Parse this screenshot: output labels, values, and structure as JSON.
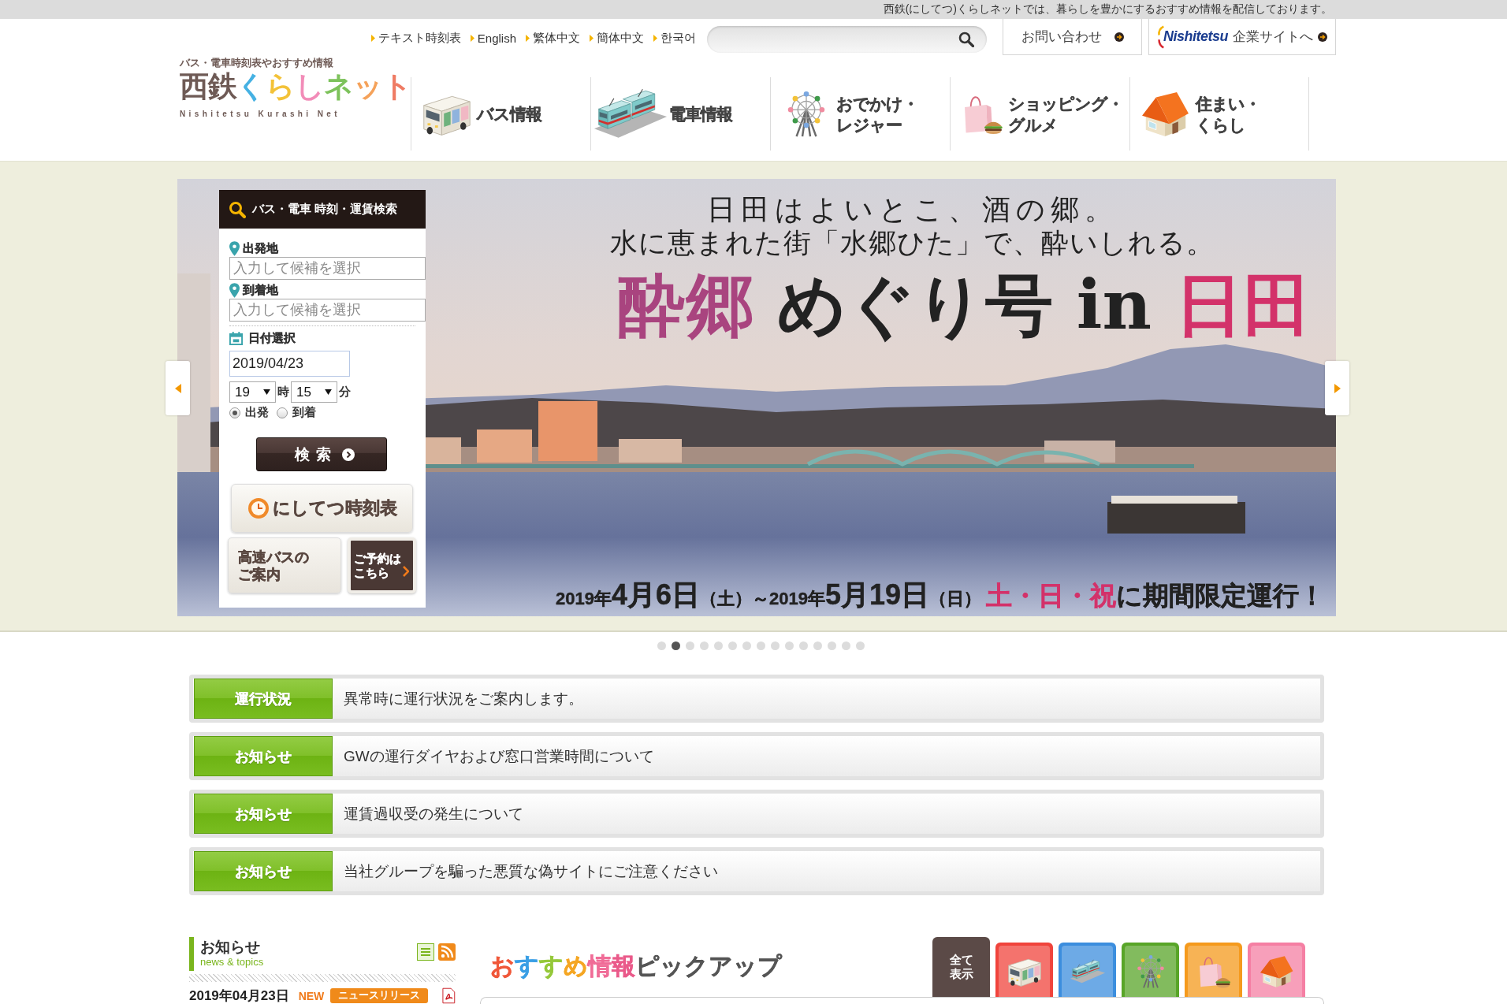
{
  "top_bar": {
    "message": "西鉄(にしてつ)くらしネットでは、暮らしを豊かにするおすすめ情報を配信しております。"
  },
  "header": {
    "language_links": [
      "テキスト時刻表",
      "English",
      "繁体中文",
      "簡体中文",
      "한국어"
    ],
    "contact_button": "お問い合わせ",
    "corporate_link": {
      "brand": "Nishitetsu",
      "label": "企業サイトへ"
    },
    "logo": {
      "tagline": "バス・電車時刻表やおすすめ情報",
      "name": "西鉄くらしネット",
      "romaji": "Nishitetsu Kurashi Net"
    }
  },
  "nav": [
    {
      "kind": "bus",
      "lines": [
        "バス情報"
      ]
    },
    {
      "kind": "train",
      "lines": [
        "電車情報"
      ]
    },
    {
      "kind": "ferris_wheel",
      "lines": [
        "おでかけ・",
        "レジャー"
      ]
    },
    {
      "kind": "shopping",
      "lines": [
        "ショッピング・",
        "グルメ"
      ]
    },
    {
      "kind": "house",
      "lines": [
        "住まい・",
        "くらし"
      ]
    }
  ],
  "route_search": {
    "title": "バス・電車 時刻・運賃検索",
    "origin": {
      "label": "出発地",
      "placeholder": "入力して候補を選択"
    },
    "destination": {
      "label": "到着地",
      "placeholder": "入力して候補を選択"
    },
    "date": {
      "label": "日付選択",
      "value": "2019/04/23"
    },
    "hour": {
      "value": "19",
      "unit": "時"
    },
    "minute": {
      "value": "15",
      "unit": "分"
    },
    "time_type": [
      {
        "label": "出発",
        "selected": true
      },
      {
        "label": "到着",
        "selected": false
      }
    ],
    "search_button": "検索",
    "timetable_button": "にしてつ時刻表",
    "highway_bus_button": [
      "高速バスの",
      "ご案内"
    ],
    "reservation_button": [
      "ご予約は",
      "こちら"
    ]
  },
  "banner": {
    "lines": [
      "日田はよいとこ、酒の郷。",
      "水に恵まれた街「水郷ひた」で、酔いしれる。"
    ],
    "headline": "**酔郷** めぐり号 in **日田**",
    "period": "2019年**4月6日**（土）～2019年**5月19日**（日）",
    "days": "土・日・祝",
    "note": "に期間限定運行！"
  },
  "slides": [
    {
      "selected": false
    },
    {
      "selected": true
    },
    {
      "selected": false
    },
    {
      "selected": false
    },
    {
      "selected": false
    },
    {
      "selected": false
    },
    {
      "selected": false
    },
    {
      "selected": false
    },
    {
      "selected": false
    },
    {
      "selected": false
    },
    {
      "selected": false
    },
    {
      "selected": false
    },
    {
      "selected": false
    },
    {
      "selected": false
    },
    {
      "selected": false
    }
  ],
  "notices": [
    {
      "category": "運行状況",
      "text": "異常時に運行状況をご案内します。"
    },
    {
      "category": "お知らせ",
      "text": "GWの運行ダイヤおよび窓口営業時間について"
    },
    {
      "category": "お知らせ",
      "text": "運賃過収受の発生について"
    },
    {
      "category": "お知らせ",
      "text": "当社グループを騙った悪質な偽サイトにご注意ください"
    }
  ],
  "news": {
    "title": "お知らせ",
    "subtitle": "news & topics",
    "items": [
      {
        "date": "2019年04月23日",
        "badge": "NEW",
        "tag": "ニュースリリース",
        "pdf": true
      }
    ]
  },
  "pickup": {
    "title": {
      "accent": "おすすめ情報",
      "rest": "ピックアップ"
    },
    "tabs": [
      {
        "kind": "all",
        "lines": [
          "全て",
          "表示"
        ],
        "color": "#5b4a47",
        "selected": true
      },
      {
        "kind": "bus",
        "color": "#f0443c",
        "selected": false
      },
      {
        "kind": "train",
        "color": "#3c8ede",
        "selected": false
      },
      {
        "kind": "ferris_wheel",
        "color": "#58a528",
        "selected": false
      },
      {
        "kind": "shopping",
        "color": "#f59a1d",
        "selected": false
      },
      {
        "kind": "house",
        "color": "#f57fa3",
        "selected": false
      }
    ]
  }
}
